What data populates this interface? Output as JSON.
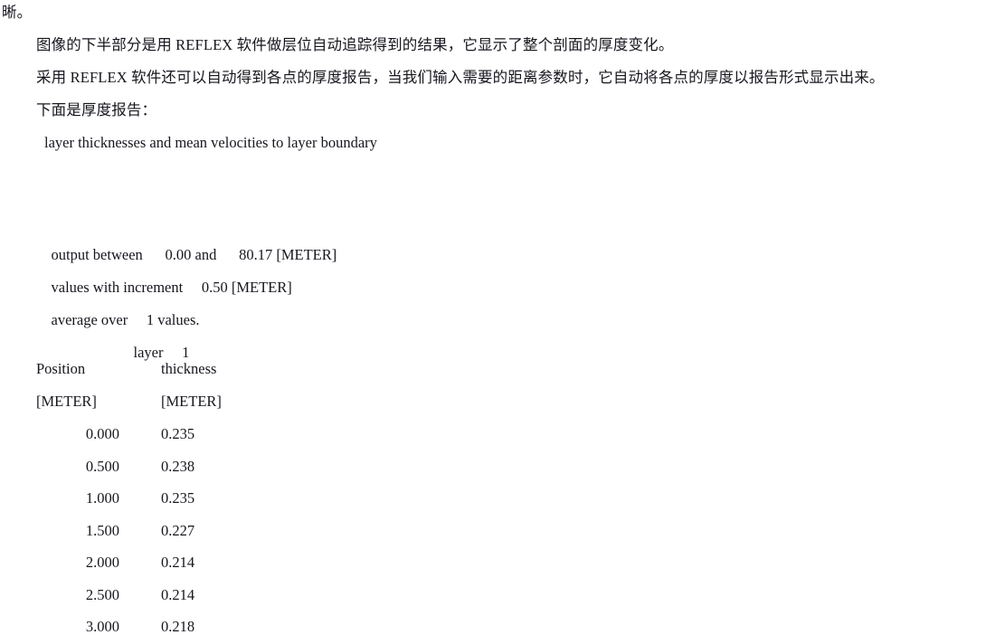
{
  "document": {
    "language": "zh-CN",
    "background_color": "#ffffff",
    "text_color": "#16161e"
  },
  "body_text": {
    "orphan_line": "晰。",
    "paragraphs": [
      "图像的下半部分是用 REFLEX 软件做层位自动追踪得到的结果，它显示了整个剖面的厚度变化。",
      "采用 REFLEX 软件还可以自动得到各点的厚度报告，当我们输入需要的距离参数时，它自动将各点的厚度以报告形式显示出来。",
      "下面是厚度报告："
    ]
  },
  "report": {
    "title": "layer thicknesses and mean velocities to layer boundary",
    "params": {
      "output_between_label": "output between",
      "output_from": "0.00",
      "output_and": "and",
      "output_to": "80.17",
      "output_unit": "[METER]",
      "increment_label": "values with increment",
      "increment_value": "0.50",
      "increment_unit": "[METER]",
      "average_label": "average over",
      "average_value": "1",
      "average_suffix": "values."
    },
    "layer_header": {
      "layer_label": "layer",
      "layer_number": "1"
    },
    "columns": {
      "position_label": "Position",
      "thickness_label": "thickness",
      "position_unit": "[METER]",
      "thickness_unit": "[METER]"
    },
    "rows": [
      {
        "position": "0.000",
        "thickness": "0.235"
      },
      {
        "position": "0.500",
        "thickness": "0.238"
      },
      {
        "position": "1.000",
        "thickness": "0.235"
      },
      {
        "position": "1.500",
        "thickness": "0.227"
      },
      {
        "position": "2.000",
        "thickness": "0.214"
      },
      {
        "position": "2.500",
        "thickness": "0.214"
      },
      {
        "position": "3.000",
        "thickness": "0.218"
      }
    ]
  }
}
